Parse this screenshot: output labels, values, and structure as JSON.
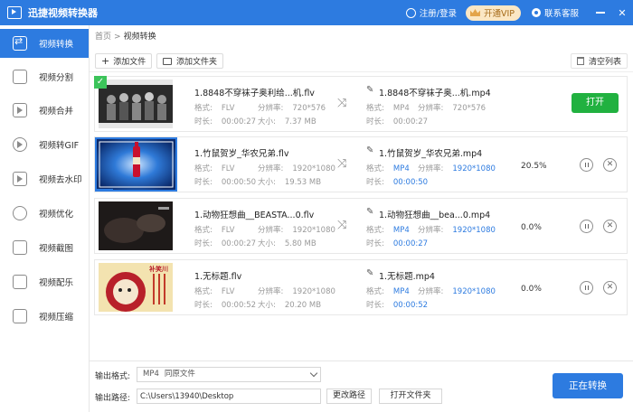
{
  "app": {
    "title": "迅捷视频转换器"
  },
  "header": {
    "login_label": "注册/登录",
    "vip_label": "开通VIP",
    "service_label": "联系客服",
    "minimize": "—",
    "close": "✕"
  },
  "sidebar": {
    "items": [
      {
        "label": "视频转换",
        "icon": "convert-icon"
      },
      {
        "label": "视频分割",
        "icon": "split-icon"
      },
      {
        "label": "视频合并",
        "icon": "merge-icon"
      },
      {
        "label": "视频转GIF",
        "icon": "gif-icon"
      },
      {
        "label": "视频去水印",
        "icon": "watermark-icon"
      },
      {
        "label": "视频优化",
        "icon": "optimize-icon"
      },
      {
        "label": "视频截图",
        "icon": "screenshot-icon"
      },
      {
        "label": "视频配乐",
        "icon": "music-icon"
      },
      {
        "label": "视频压缩",
        "icon": "compress-icon"
      }
    ]
  },
  "breadcrumb": {
    "home": "首页",
    "sep": ">",
    "current": "视频转换"
  },
  "toolbar": {
    "add_file": "添加文件",
    "add_folder": "添加文件夹",
    "clear_list": "清空列表"
  },
  "labels": {
    "format": "格式:",
    "resolution": "分辨率:",
    "duration": "时长:",
    "size": "大小:"
  },
  "files": [
    {
      "src_name": "1.8848不穿袜子奥利给...机.flv",
      "src_format": "FLV",
      "src_resolution": "720*576",
      "src_duration": "00:00:27",
      "src_size": "7.37 MB",
      "dst_name": "1.8848不穿袜子奥...机.mp4",
      "dst_format": "MP4",
      "dst_resolution": "720*576",
      "dst_duration": "00:00:27",
      "status": "done",
      "open_label": "打开",
      "check": "✓"
    },
    {
      "src_name": "1.竹鼠贺岁_华农兄弟.flv",
      "src_format": "FLV",
      "src_resolution": "1920*1080",
      "src_duration": "00:00:50",
      "src_size": "19.53 MB",
      "dst_name": "1.竹鼠贺岁_华农兄弟.mp4",
      "dst_format": "MP4",
      "dst_resolution": "1920*1080",
      "dst_duration": "00:00:50",
      "status": "processing",
      "percent": "20.5%",
      "progress": 0.205
    },
    {
      "src_name": "1.动物狂想曲__BEASTA...0.flv",
      "src_format": "FLV",
      "src_resolution": "1920*1080",
      "src_duration": "00:00:27",
      "src_size": "5.80 MB",
      "dst_name": "1.动物狂想曲__bea...0.mp4",
      "dst_format": "MP4",
      "dst_resolution": "1920*1080",
      "dst_duration": "00:00:27",
      "status": "waiting",
      "percent": "0.0%"
    },
    {
      "src_name": "1.无标题.flv",
      "src_format": "FLV",
      "src_resolution": "1920*1080",
      "src_duration": "00:00:52",
      "src_size": "20.20 MB",
      "dst_name": "1.无标题.mp4",
      "dst_format": "MP4",
      "dst_resolution": "1920*1080",
      "dst_duration": "00:00:52",
      "status": "waiting",
      "percent": "0.0%",
      "thumb_text": "补笑川"
    }
  ],
  "bottom": {
    "format_label": "输出格式:",
    "format_value": "MP4",
    "format_sub": "同原文件",
    "path_label": "输出路径:",
    "path_value": "C:\\Users\\13940\\Desktop",
    "change_path": "更改路径",
    "open_folder": "打开文件夹",
    "convert": "正在转换"
  }
}
